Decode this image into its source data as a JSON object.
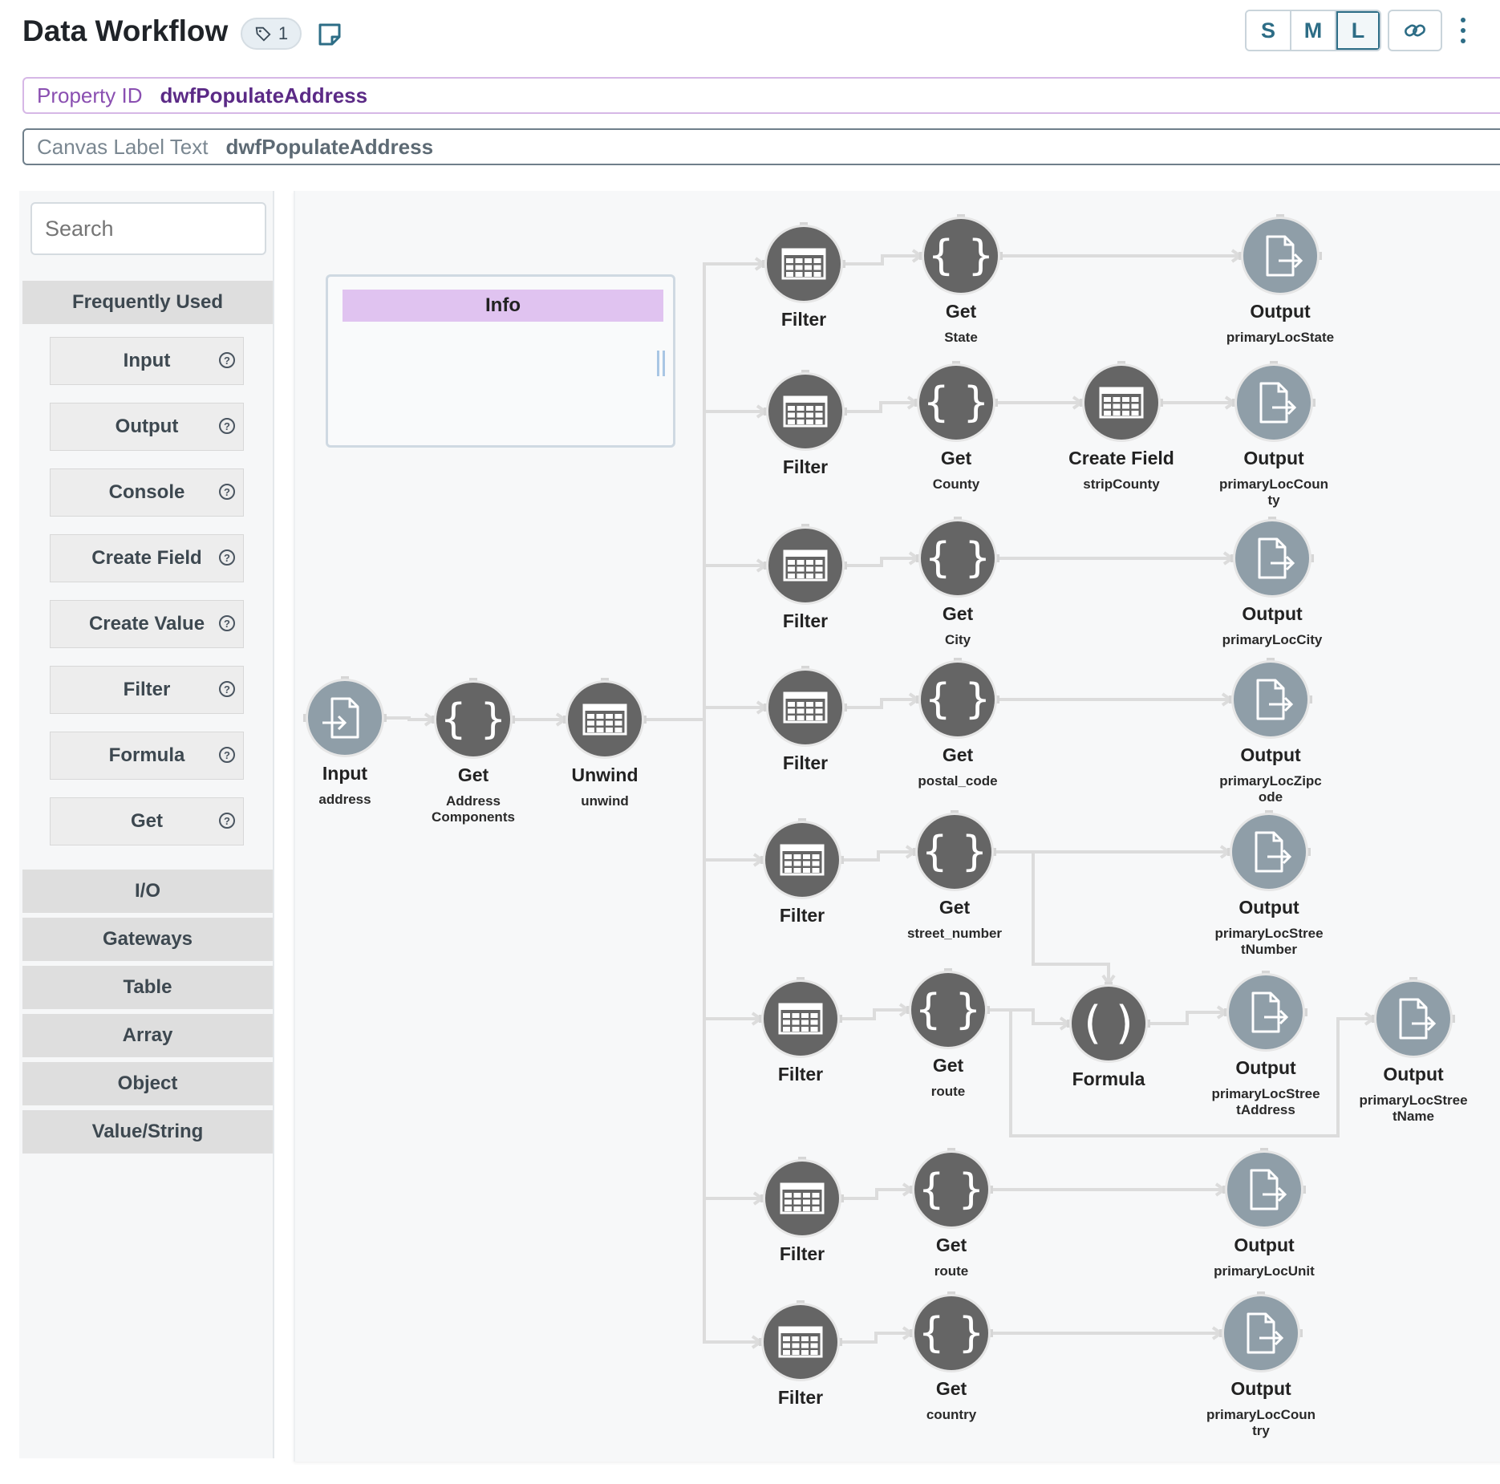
{
  "header": {
    "title": "Data Workflow",
    "tag_count": "1",
    "sizes": [
      "S",
      "M",
      "L"
    ],
    "active_size": "L"
  },
  "property": {
    "label": "Property ID",
    "value": "dwfPopulateAddress"
  },
  "canvas_label": {
    "label": "Canvas Label Text",
    "value": "dwfPopulateAddress"
  },
  "sidebar": {
    "search_placeholder": "Search",
    "frequently_used": "Frequently Used",
    "items": [
      "Input",
      "Output",
      "Console",
      "Create Field",
      "Create Value",
      "Filter",
      "Formula",
      "Get"
    ],
    "help_glyph": "?",
    "categories": [
      "I/O",
      "Gateways",
      "Table",
      "Array",
      "Object",
      "Value/String"
    ]
  },
  "info": {
    "title": "Info"
  },
  "colors": {
    "node_dark": "#656565",
    "node_io": "#8f9ea8",
    "edge": "#dcdcdc",
    "accent": "#2d6d86",
    "property_border": "#d6b7e6",
    "info_header": "#e0c3f0"
  },
  "workflow": {
    "nodes": [
      {
        "id": "input",
        "type": "input-icon",
        "title": "Input",
        "sub": "address"
      },
      {
        "id": "getAddr",
        "type": "braces-icon",
        "title": "Get",
        "sub": "Address\nComponents"
      },
      {
        "id": "unwind",
        "type": "table-icon",
        "title": "Unwind",
        "sub": "unwind"
      },
      {
        "id": "f1",
        "type": "table-icon",
        "title": "Filter",
        "sub": ""
      },
      {
        "id": "g1",
        "type": "braces-icon",
        "title": "Get",
        "sub": "State"
      },
      {
        "id": "o1",
        "type": "output-icon",
        "title": "Output",
        "sub": "primaryLocState"
      },
      {
        "id": "f2",
        "type": "table-icon",
        "title": "Filter",
        "sub": ""
      },
      {
        "id": "g2",
        "type": "braces-icon",
        "title": "Get",
        "sub": "County"
      },
      {
        "id": "cf",
        "type": "table-icon",
        "title": "Create Field",
        "sub": "stripCounty"
      },
      {
        "id": "o2",
        "type": "output-icon",
        "title": "Output",
        "sub": "primaryLocCoun\nty"
      },
      {
        "id": "f3",
        "type": "table-icon",
        "title": "Filter",
        "sub": ""
      },
      {
        "id": "g3",
        "type": "braces-icon",
        "title": "Get",
        "sub": "City"
      },
      {
        "id": "o3",
        "type": "output-icon",
        "title": "Output",
        "sub": "primaryLocCity"
      },
      {
        "id": "f4",
        "type": "table-icon",
        "title": "Filter",
        "sub": ""
      },
      {
        "id": "g4",
        "type": "braces-icon",
        "title": "Get",
        "sub": "postal_code"
      },
      {
        "id": "o4",
        "type": "output-icon",
        "title": "Output",
        "sub": "primaryLocZipc\node"
      },
      {
        "id": "f5",
        "type": "table-icon",
        "title": "Filter",
        "sub": ""
      },
      {
        "id": "g5",
        "type": "braces-icon",
        "title": "Get",
        "sub": "street_number"
      },
      {
        "id": "o5",
        "type": "output-icon",
        "title": "Output",
        "sub": "primaryLocStree\ntNumber"
      },
      {
        "id": "f6",
        "type": "table-icon",
        "title": "Filter",
        "sub": ""
      },
      {
        "id": "g6",
        "type": "braces-icon",
        "title": "Get",
        "sub": "route"
      },
      {
        "id": "fm",
        "type": "parens-icon",
        "title": "Formula",
        "sub": ""
      },
      {
        "id": "o6",
        "type": "output-icon",
        "title": "Output",
        "sub": "primaryLocStree\ntAddress"
      },
      {
        "id": "o6b",
        "type": "output-icon",
        "title": "Output",
        "sub": "primaryLocStree\ntName"
      },
      {
        "id": "f7",
        "type": "table-icon",
        "title": "Filter",
        "sub": ""
      },
      {
        "id": "g7",
        "type": "braces-icon",
        "title": "Get",
        "sub": "route"
      },
      {
        "id": "o7",
        "type": "output-icon",
        "title": "Output",
        "sub": "primaryLocUnit"
      },
      {
        "id": "f8",
        "type": "table-icon",
        "title": "Filter",
        "sub": ""
      },
      {
        "id": "g8",
        "type": "braces-icon",
        "title": "Get",
        "sub": "country"
      },
      {
        "id": "o8",
        "type": "output-icon",
        "title": "Output",
        "sub": "primaryLocCoun\ntry"
      }
    ],
    "edges": [
      [
        "input",
        "getAddr"
      ],
      [
        "getAddr",
        "unwind"
      ],
      [
        "unwind",
        "f1"
      ],
      [
        "unwind",
        "f2"
      ],
      [
        "unwind",
        "f3"
      ],
      [
        "unwind",
        "f4"
      ],
      [
        "unwind",
        "f5"
      ],
      [
        "unwind",
        "f6"
      ],
      [
        "unwind",
        "f7"
      ],
      [
        "unwind",
        "f8"
      ],
      [
        "f1",
        "g1"
      ],
      [
        "g1",
        "o1"
      ],
      [
        "f2",
        "g2"
      ],
      [
        "g2",
        "cf"
      ],
      [
        "cf",
        "o2"
      ],
      [
        "f3",
        "g3"
      ],
      [
        "g3",
        "o3"
      ],
      [
        "f4",
        "g4"
      ],
      [
        "g4",
        "o4"
      ],
      [
        "f5",
        "g5"
      ],
      [
        "g5",
        "o5"
      ],
      [
        "g5",
        "fm"
      ],
      [
        "f6",
        "g6"
      ],
      [
        "g6",
        "fm"
      ],
      [
        "g6",
        "o6b"
      ],
      [
        "fm",
        "o6"
      ],
      [
        "f7",
        "g7"
      ],
      [
        "g7",
        "o7"
      ],
      [
        "f8",
        "g8"
      ],
      [
        "g8",
        "o8"
      ]
    ]
  }
}
